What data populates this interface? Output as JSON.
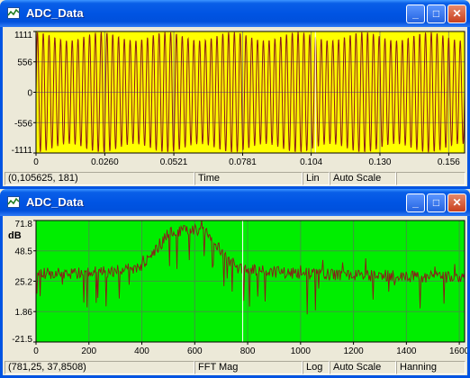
{
  "windows": [
    {
      "title": "ADC_Data",
      "status": [
        "(0,105625, 181)",
        "Time",
        "Lin",
        "Auto Scale",
        ""
      ],
      "colors": {
        "background": "#ffff00",
        "trace": "#8b1a1a",
        "grid": "#9a9a55",
        "cursor": "#ffffff"
      },
      "chart_data": {
        "type": "line",
        "title": "",
        "xlabel": "",
        "ylabel": "",
        "x_ticks": [
          "0",
          "0.0260",
          "0.0521",
          "0.0781",
          "0.104",
          "0.130",
          "0.156"
        ],
        "x_tick_values": [
          0,
          0.026,
          0.0521,
          0.0781,
          0.104,
          0.13,
          0.156
        ],
        "y_ticks": [
          "1111",
          "556",
          "0",
          "-556",
          "-1111"
        ],
        "y_tick_values": [
          1111,
          556,
          0,
          -556,
          -1111
        ],
        "xlim": [
          0,
          0.162
        ],
        "ylim": [
          -1111,
          1111
        ],
        "cursor_x": 0.1056,
        "signal": {
          "description": "sinusoid",
          "amplitude": 1100,
          "approx_cycles": 74
        },
        "grid": true
      }
    },
    {
      "title": "ADC_Data",
      "status": [
        "(781,25, 37,8508)",
        "FFT Mag",
        "Log",
        "Auto Scale",
        "Hanning"
      ],
      "colors": {
        "background": "#00ee00",
        "trace": "#8b1a1a",
        "grid": "#3d9a3d",
        "cursor": "#ffffff"
      },
      "chart_data": {
        "type": "line",
        "title": "",
        "xlabel": "",
        "ylabel": "dB",
        "x_ticks": [
          "0",
          "200",
          "400",
          "600",
          "800",
          "1000",
          "1200",
          "1400",
          "1600"
        ],
        "x_tick_values": [
          0,
          200,
          400,
          600,
          800,
          1000,
          1200,
          1400,
          1600
        ],
        "y_ticks": [
          "71.8",
          "48.5",
          "25.2",
          "1.86",
          "-21.5"
        ],
        "y_tick_values": [
          71.8,
          48.5,
          25.2,
          1.86,
          -21.5
        ],
        "xlim": [
          0,
          1620
        ],
        "ylim": [
          -21.5,
          71.8
        ],
        "cursor_x": 781.25,
        "spectrum_envelope": {
          "x": [
            0,
            100,
            200,
            300,
            400,
            460,
            500,
            560,
            600,
            650,
            700,
            740,
            780,
            850,
            1000,
            1200,
            1400,
            1620
          ],
          "y": [
            31,
            31,
            32,
            33,
            36,
            50,
            62,
            64,
            65,
            62,
            48,
            38,
            34,
            33,
            31,
            30,
            29,
            28
          ]
        },
        "grid": true
      }
    }
  ]
}
